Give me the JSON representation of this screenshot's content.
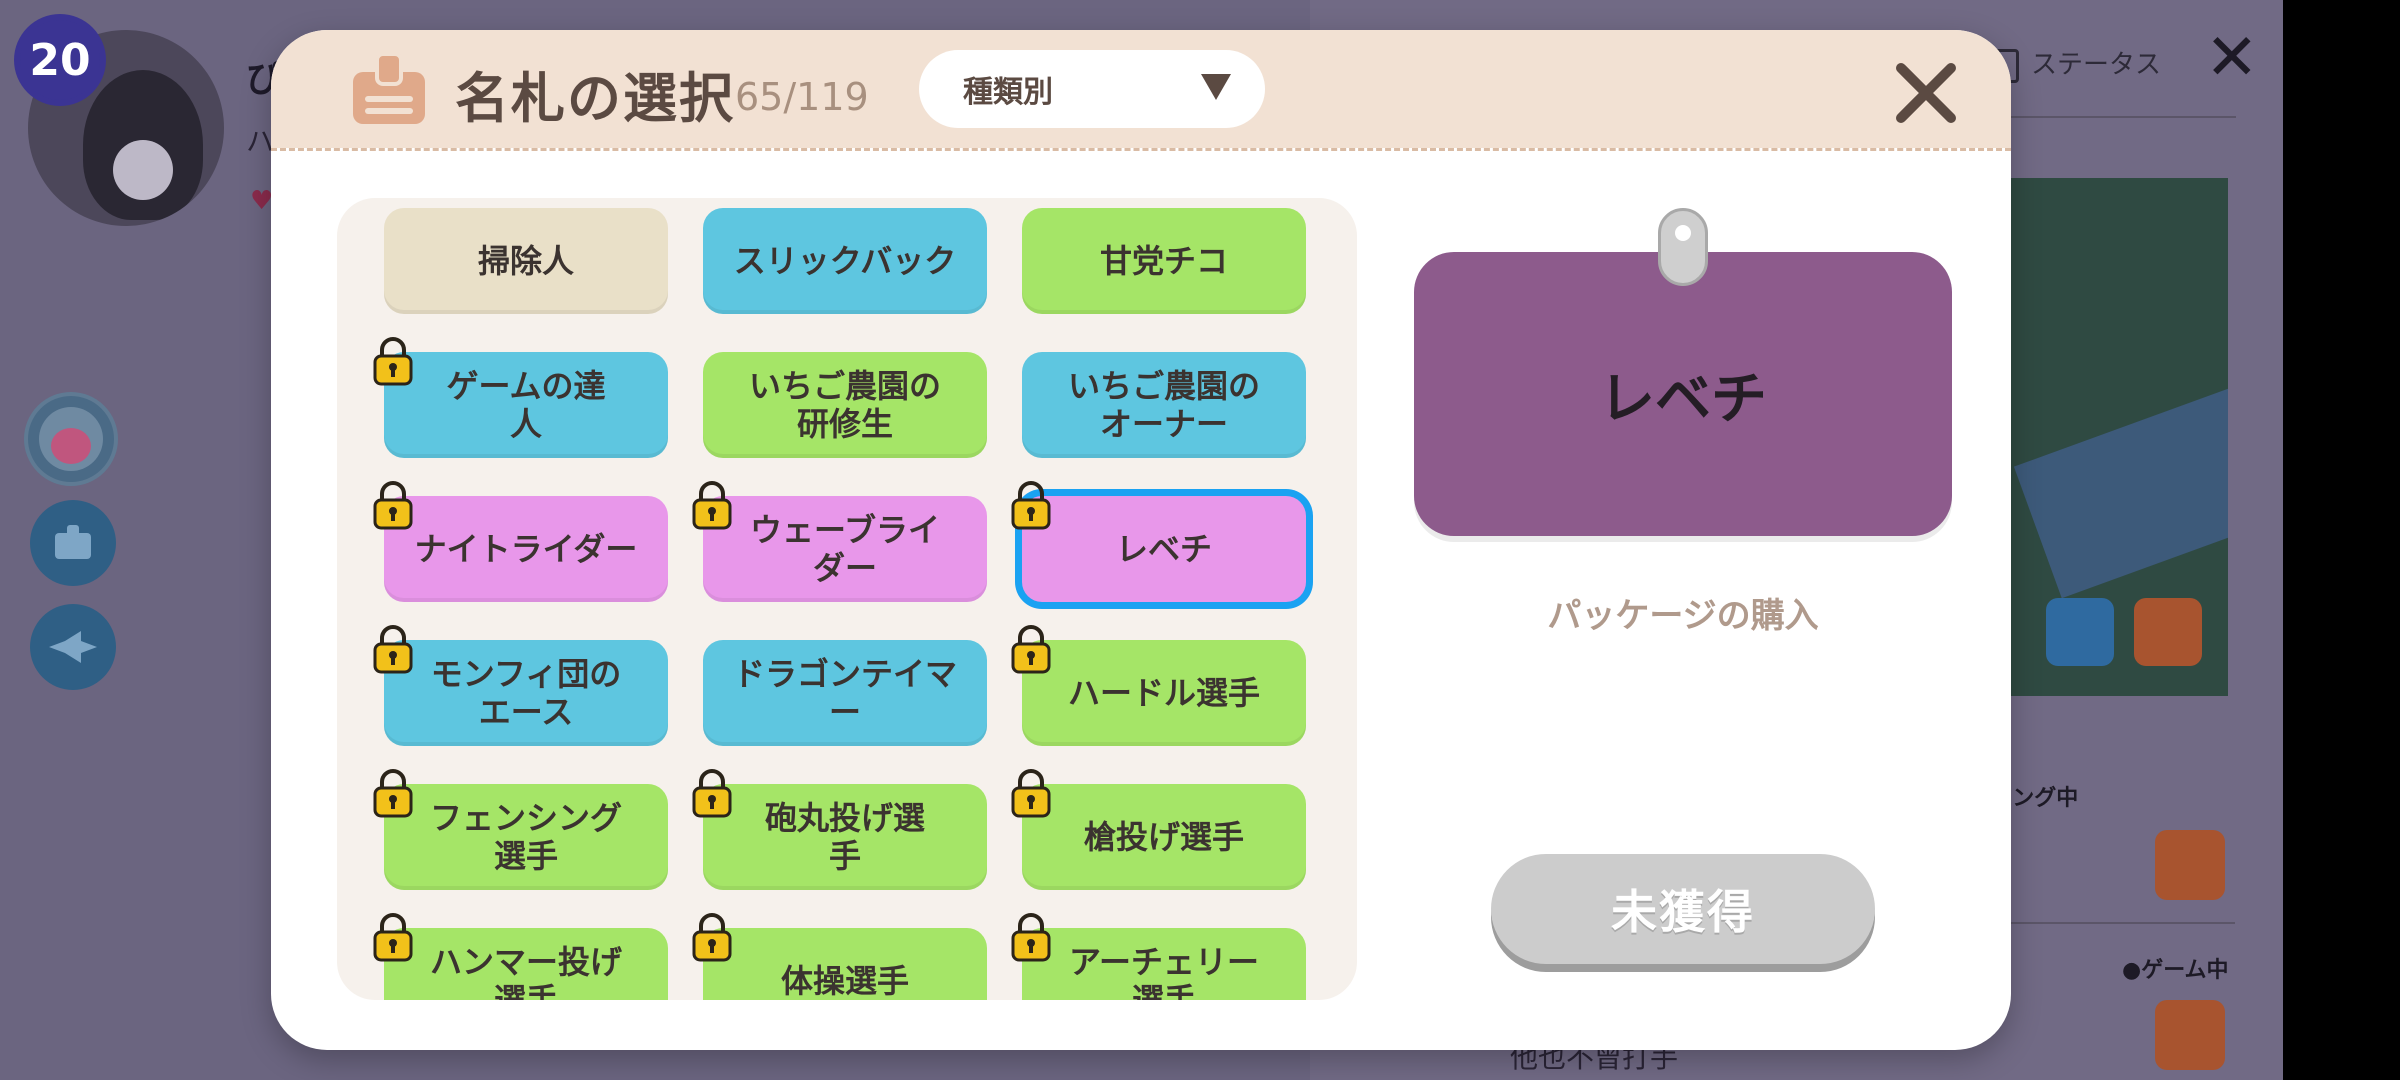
{
  "background": {
    "level": "20",
    "player_name": "ぴ",
    "player_subtitle": "ハ",
    "heart": "♥",
    "status_label": "ステータス",
    "event_label_1": "●リモデリング中",
    "event_label_2": "●ゲーム中",
    "bottom_text": "他也不曾打手"
  },
  "modal": {
    "title": "名札の選択",
    "count": "65/119",
    "filter": {
      "selected": "種類別"
    }
  },
  "tags": [
    {
      "label": "掃除人",
      "color": "beige",
      "locked": false
    },
    {
      "label": "スリックバック",
      "color": "blue",
      "locked": false
    },
    {
      "label": "甘党チコ",
      "color": "green",
      "locked": false
    },
    {
      "label": "ゲームの達\n人",
      "color": "blue",
      "locked": true
    },
    {
      "label": "いちご農園の\n研修生",
      "color": "green",
      "locked": false
    },
    {
      "label": "いちご農園の\nオーナー",
      "color": "blue",
      "locked": false
    },
    {
      "label": "ナイトライダー",
      "color": "pink",
      "locked": true
    },
    {
      "label": "ウェーブライ\nダー",
      "color": "pink",
      "locked": true
    },
    {
      "label": "レベチ",
      "color": "pink",
      "locked": true,
      "selected": true
    },
    {
      "label": "モンフィ団の\nエース",
      "color": "blue",
      "locked": true
    },
    {
      "label": "ドラゴンテイマ\nー",
      "color": "blue",
      "locked": false
    },
    {
      "label": "ハードル選手",
      "color": "green",
      "locked": true
    },
    {
      "label": "フェンシング\n選手",
      "color": "green",
      "locked": true
    },
    {
      "label": "砲丸投げ選\n手",
      "color": "green",
      "locked": true
    },
    {
      "label": "槍投げ選手",
      "color": "green",
      "locked": true
    },
    {
      "label": "ハンマー投げ\n選手",
      "color": "green",
      "locked": true
    },
    {
      "label": "体操選手",
      "color": "green",
      "locked": true
    },
    {
      "label": "アーチェリー\n選手",
      "color": "green",
      "locked": true
    }
  ],
  "preview": {
    "name": "レベチ",
    "card_color": "#8d5b8c",
    "caption": "パッケージの購入",
    "status_button": "未獲得"
  },
  "colors": {
    "beige": "#e9e0c8",
    "blue": "#5ec6e0",
    "green": "#a5e567",
    "pink": "#e897ea",
    "selected_border": "#1aa2f2",
    "lock": "#f2c11a"
  }
}
